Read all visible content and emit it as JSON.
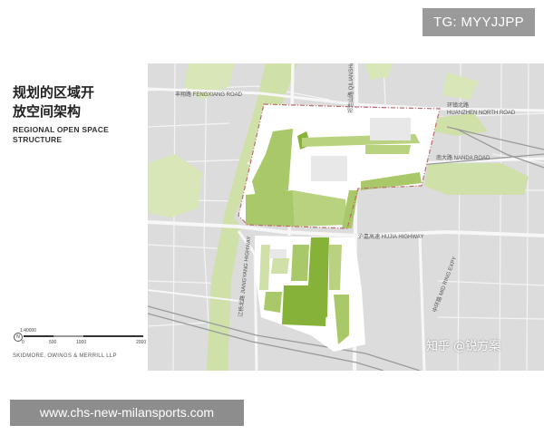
{
  "badge_top": "TG: MYYJJPP",
  "title": {
    "cn_line1": "规划的区域开",
    "cn_line2": "放空间架构",
    "en_line1": "REGIONAL OPEN SPACE",
    "en_line2": "STRUCTURE"
  },
  "scale": {
    "ratio": "1:40000",
    "north": "N",
    "ticks": [
      "0",
      "500",
      "1000",
      "2000"
    ]
  },
  "firm": "SKIDMORE, OWINGS & MERRILL LLP",
  "map": {
    "roads": {
      "fengxiang": "丰翔路 FENGXIANG ROAD",
      "huanzhen_cn": "环镇北路",
      "huanzhen_en": "HUANZHEN NORTH ROAD",
      "nanda": "南大路 NANDA ROAD",
      "qianshan": "祁连山路 QILIANSHAN ROAD",
      "hujia": "沪嘉高速 HUJIA HIGHWAY",
      "jiangyang": "江杨北路 JIANGYANG HIGHWAY",
      "s20": "中环路 MID RING EXPY"
    }
  },
  "watermark": "知乎 @锐方案",
  "badge_bottom": "www.chs-new-milansports.com",
  "colors": {
    "green_light": "#cfe0a8",
    "green_mid": "#a9c86a",
    "green_dark": "#86b23a",
    "base": "#dcdcdc",
    "road": "#f7f7f7",
    "boundary": "#c06a6a"
  }
}
